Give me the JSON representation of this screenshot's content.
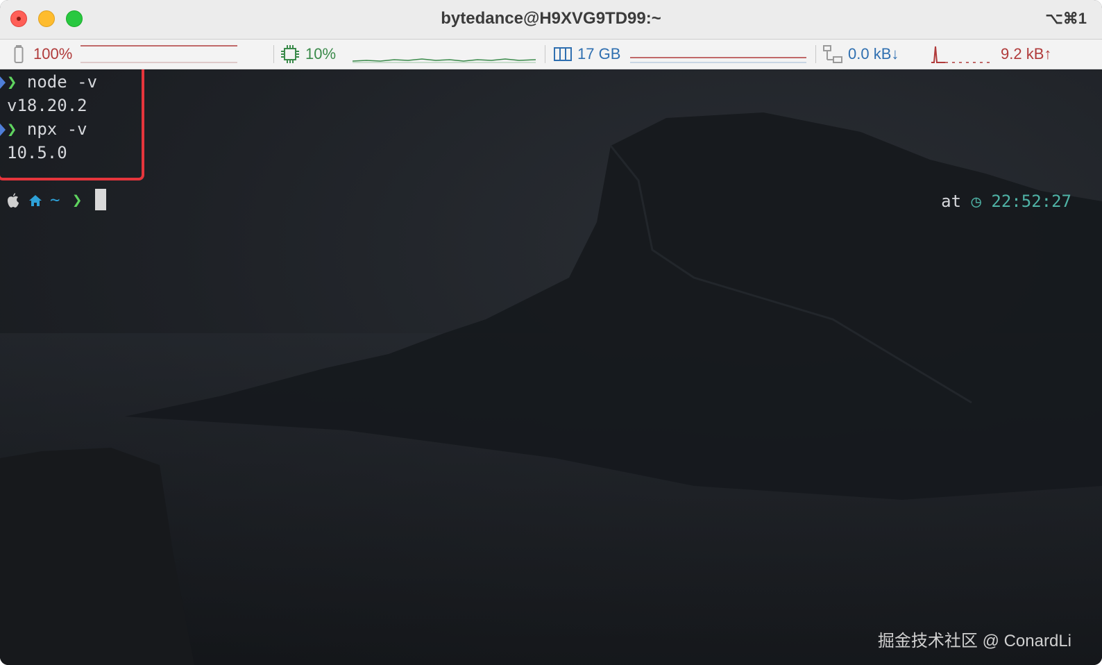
{
  "window": {
    "title": "bytedance@H9XVG9TD99:~",
    "shortcut": "⌥⌘1"
  },
  "status": {
    "battery": {
      "label": "100%",
      "color": "#b03a3a"
    },
    "cpu": {
      "label": "10%",
      "color": "#3a8a4a"
    },
    "memory": {
      "label": "17 GB",
      "color": "#2f6fb0"
    },
    "net_down": {
      "label": "0.0 kB↓",
      "color": "#2f6fb0"
    },
    "net_up": {
      "label": "9.2 kB↑",
      "color": "#b03a3a"
    }
  },
  "terminal": {
    "lines": [
      {
        "prompt": "❯",
        "text": "node -v"
      },
      {
        "text": "v18.20.2"
      },
      {
        "prompt": "❯",
        "text": "npx -v"
      },
      {
        "text": "10.5.0"
      }
    ],
    "prompt": {
      "dir": "~",
      "arrow": "❯"
    },
    "rprompt": {
      "at": "at",
      "clock": "◷",
      "time": "22:52:27"
    }
  },
  "watermark": "掘金技术社区 @ ConardLi",
  "colors": {
    "highlight": "#e5353c",
    "prompt_green": "#5fd35f",
    "dir_blue": "#2ea1d8",
    "time_teal": "#4fb3a6"
  }
}
